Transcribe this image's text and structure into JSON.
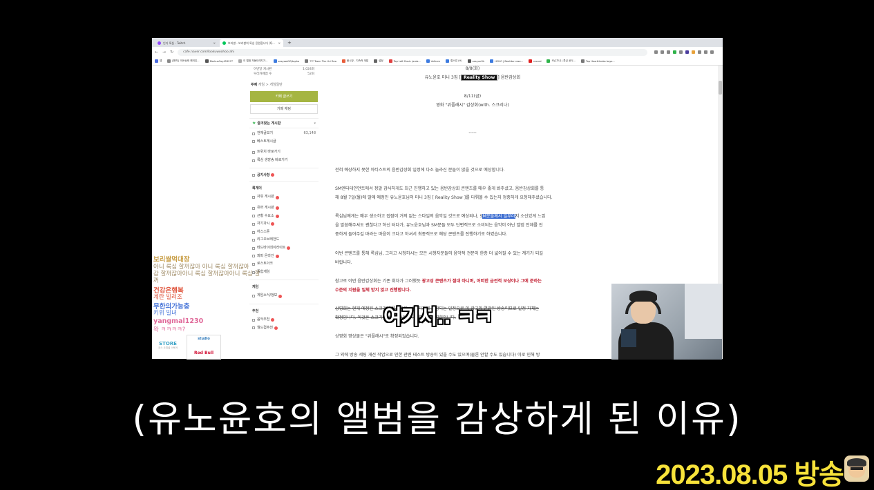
{
  "browser": {
    "tabs": [
      {
        "label": "인디 록심 - Twitch",
        "active": false
      },
      {
        "label": "보리쌀 - 보리쌀의 록심 응원합니다 (Q...",
        "active": true
      }
    ],
    "url": "cafe.naver.com/lookuwoohoo.ahi",
    "bookmarks": [
      "앱",
      "[원작] '이든상태 해외뮤...",
      "MarkusCoy453977",
      "이 앨범 자동트레지가...",
      "sesyook50/tapho",
      "??? Teem Tim Uri Dea",
      "음시장 - 지속적 계발",
      "설정",
      "Top Lofi Music (amb...",
      "Velhem",
      "철스업 (H)",
      "sesyunOk",
      "HCHO | Beetitor reso...",
      "record",
      "카슈기내 | 록심 공식...",
      "Top Heartthrobs boys..."
    ]
  },
  "sidebar": {
    "top_rows": [
      {
        "label": "이번달 게시판",
        "value": "1,024회"
      },
      {
        "label": "우리카페멤 수",
        "value": "52회"
      }
    ],
    "topic_label": "주제",
    "topic_value": "게임 > 게임일반",
    "write_button": "카페 글쓰기",
    "chat_button": "카페 채팅",
    "fav_title": "즐겨찾는 게시판",
    "items": [
      {
        "label": "전체글보기",
        "count": "63,148"
      },
      {
        "label": "베스트게시글",
        "count": ""
      },
      {
        "label": "트위치 바로가기",
        "count": ""
      },
      {
        "label": "록심 생방송 바로가기",
        "count": ""
      }
    ],
    "notice": "공지사항",
    "section_community": "록게더",
    "community_items": [
      "자유 게시판",
      "유머 게시판",
      "근황 수요소",
      "자기과시",
      "하스스톤",
      "리그오브레전드",
      "테드바이데이라이트",
      "피파 온라인",
      "로스트아크",
      "종합게임"
    ],
    "section_game": "게임",
    "game_items": [
      "게임소식/정보"
    ],
    "section_recommend": "추천",
    "recommend_items": [
      "음악추천",
      "월드컵추천"
    ]
  },
  "article": {
    "date1": "8/8(화)",
    "line_album_prefix": "유노윤호 미니 3집 [",
    "line_album_badge": "Reality Show",
    "line_album_suffix": "] 음반감상회",
    "date2": "8/11(금)",
    "line_movie": "영화 \"위플래시\" 감상회(with. 스크리나)",
    "divider": "-----",
    "p1": "전혀 예상하지 못한 아티스트의 음반감상회 일정에 다소 놀라신 분들이 많을 것으로 예상합니다.",
    "p2a": "SM엔터테인먼트에서 정말 감사하게도 최근 진행하고 있는 음반감상회 콘텐츠를 매우 좋게 봐주셨고, 음반감상회를 통",
    "p2b": "해 8월 7일(월)에 발매 예정인 유노윤호님의 미니 3집 [ Reality Show ]를 다뤄볼 수 있는지 정중하게 요청해주셨습니다.",
    "p3a_pre": "록심님에게는 매우 생소하고 접점이 거의 없는 스타일의 음악일 것으로 예상되나, S",
    "p3a_hl": "M분들께서 일부러",
    "p3a_post": "지 소신있게 느낌",
    "p3b": "을 말씀해주셔도 괜찮다고 하신 터다가, 유노윤호님과 SM분들 모두 단편적으로 소비되는 음악이 아닌 앨범 전체를 진",
    "p3c": "중하게 들어주길 바라는 마음이 크다고 하셔서 최종적으로 해당 콘텐츠를 진행하기로 하였습니다.",
    "p4a": "이번 콘텐츠를 통해 록심님, 그리고 시청하시는 모든 시청자분들의 음악적 견문이 한층 더 넓어질 수 있는 계기가 되길",
    "p4b": "바랍니다.",
    "p5a_pre": "참고로 이번 음반감상회는 기존 회차가 그러했듯 ",
    "p5a_red": "광고성 콘텐츠가 절대 아니며, 어떠한 금전적 보상이나 그에 준하는",
    "p5b_red": "수준의 지원을 일체 받지 않고 진행합니다.",
    "p6a": "상영회는 현재 예정된 스크리나 플랫폼의 시범 기간에 포함되는 일정으로 이 광고와 연관된 방송이므로 일정 자체는",
    "p6b": "확정입니다. 이것은 스크리나 서비스 내에서 이뤄지는 상영회입니다.",
    "p7": "상영회 영상물은 \"위플래시\"로 확정되었습니다.",
    "p8": "그 외에 방송 세팅 개선 작업으로 인한 관련 테스트 방송이 있을 수도 있으며(물론 안할 수도 있습니다) 이로 인해 방"
  },
  "ghost_chat": [
    {
      "name": "보리쌀먹대장",
      "msg": "아니 록심 할꺼잖아 아니 록심 할꺼잖아",
      "color": "#c9a04a"
    },
    {
      "name": "",
      "msg": "감 할꺼잖아아니 록심 할꺼잖아아니 록심 할",
      "color": "#9e8a64"
    },
    {
      "name": "",
      "msg": "꺼",
      "color": "#9e8a64"
    },
    {
      "name": "건강은행복",
      "msg": "계란 빌려조",
      "color": "#e0573f"
    },
    {
      "name": "무한의가능충",
      "msg": "키위 빌녀",
      "color": "#4a77d9"
    },
    {
      "name": "yangmal1230",
      "msg": "왁 ㅋㅋㅋㅋ?",
      "color": "#e06a9a"
    }
  ],
  "ads": {
    "store": "STORE",
    "store_sub": "코스 오피셜 스토어",
    "redbull_top": "studio",
    "redbull": "Red Bull"
  },
  "overlay_caption": "여기서.. ㅋㅋ",
  "subtitle": "(유노윤호의 앨범을 감상하게 된 이유)",
  "date_label": "2023.08.05 방송"
}
